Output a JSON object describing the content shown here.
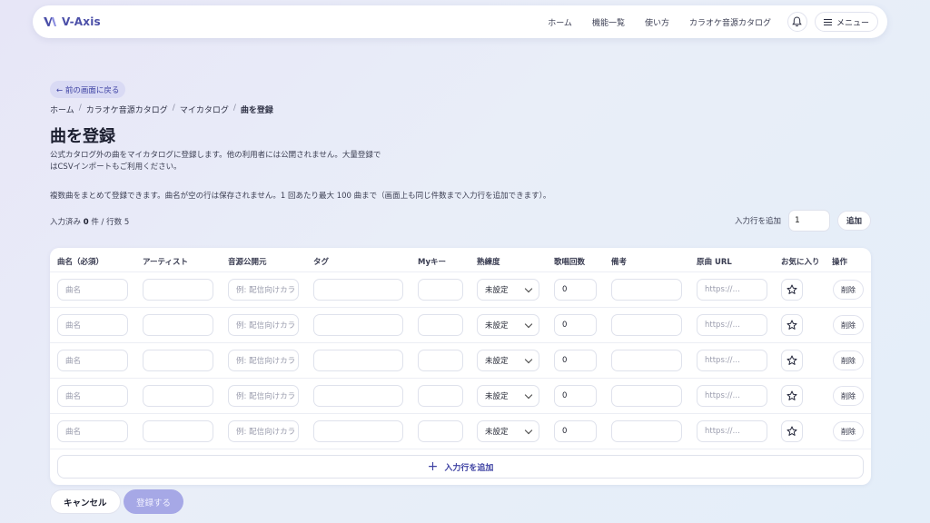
{
  "header": {
    "brand": "V-Axis",
    "nav": [
      "ホーム",
      "機能一覧",
      "使い方",
      "カラオケ音源カタログ"
    ],
    "menu_label": "メニュー"
  },
  "back_label": "← 前の画面に戻る",
  "breadcrumb": {
    "items": [
      "ホーム",
      "カラオケ音源カタログ",
      "マイカタログ"
    ],
    "current": "曲を登録",
    "separator": "/"
  },
  "page": {
    "title": "曲を登録",
    "description": "公式カタログ外の曲をマイカタログに登録します。他の利用者には公開されません。大量登録ではCSVインポートもご利用ください。",
    "note": "複数曲をまとめて登録できます。曲名が空の行は保存されません。1 回あたり最大 100 曲まで（画面上も同じ件数まで入力行を追加できます）。",
    "counter": {
      "prefix": "入力済み",
      "filled": "0",
      "mid": "件 / 行数",
      "rows": "5"
    }
  },
  "add_rows": {
    "label": "入力行を追加",
    "value": "1",
    "button": "追加"
  },
  "table": {
    "columns": [
      "曲名（必須）",
      "アーティスト",
      "音源公開元",
      "タグ",
      "Myキー",
      "熟練度",
      "歌唱回数",
      "備考",
      "原曲 URL",
      "お気に入り",
      "操作"
    ],
    "rows": [
      {
        "title_ph": "曲名",
        "source_ph": "例: 配信向けカラ",
        "skill": "未設定",
        "count": "0",
        "url_ph": "https://…",
        "delete": "削除"
      },
      {
        "title_ph": "曲名",
        "source_ph": "例: 配信向けカラ",
        "skill": "未設定",
        "count": "0",
        "url_ph": "https://…",
        "delete": "削除"
      },
      {
        "title_ph": "曲名",
        "source_ph": "例: 配信向けカラ",
        "skill": "未設定",
        "count": "0",
        "url_ph": "https://…",
        "delete": "削除"
      },
      {
        "title_ph": "曲名",
        "source_ph": "例: 配信向けカラ",
        "skill": "未設定",
        "count": "0",
        "url_ph": "https://…",
        "delete": "削除"
      },
      {
        "title_ph": "曲名",
        "source_ph": "例: 配信向けカラ",
        "skill": "未設定",
        "count": "0",
        "url_ph": "https://…",
        "delete": "削除"
      }
    ],
    "add_line_label": "入力行を追加"
  },
  "footer": {
    "cancel": "キャンセル",
    "submit": "登録する"
  },
  "colors": {
    "accent": "#4b4fa8",
    "accent_soft": "#d9daf4",
    "submit_disabled": "#a6a8e6"
  }
}
